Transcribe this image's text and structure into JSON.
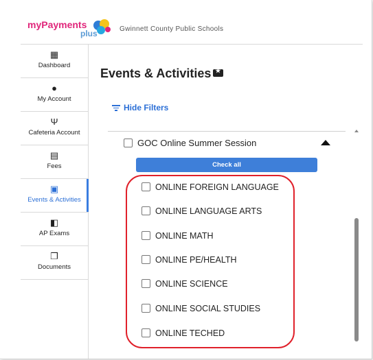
{
  "brand": {
    "logo_part1": "myPayments",
    "logo_part2": "plus",
    "school": "Gwinnett County Public Schools"
  },
  "sidebar": {
    "items": [
      {
        "label": "Dashboard",
        "icon": "dashboard-icon"
      },
      {
        "label": "My Account",
        "icon": "account-icon"
      },
      {
        "label": "Cafeteria Account",
        "icon": "cafeteria-icon"
      },
      {
        "label": "Fees",
        "icon": "fees-icon"
      },
      {
        "label": "Events & Activities",
        "icon": "ticket-icon",
        "active": true
      },
      {
        "label": "AP Exams",
        "icon": "ap-exams-icon"
      },
      {
        "label": "Documents",
        "icon": "documents-icon"
      }
    ]
  },
  "page": {
    "title": "Events & Activities"
  },
  "filters": {
    "toggle_label": "Hide Filters"
  },
  "session": {
    "label": "GOC Online Summer Session"
  },
  "check_all_label": "Check all",
  "options": [
    "ONLINE FOREIGN LANGUAGE",
    "ONLINE LANGUAGE ARTS",
    "ONLINE MATH",
    "ONLINE PE/HEALTH",
    "ONLINE SCIENCE",
    "ONLINE SOCIAL STUDIES",
    "ONLINE TECHED"
  ],
  "colors": {
    "accent": "#3e7fd9",
    "highlight": "#e0202a",
    "brand_pink": "#e0257a"
  }
}
